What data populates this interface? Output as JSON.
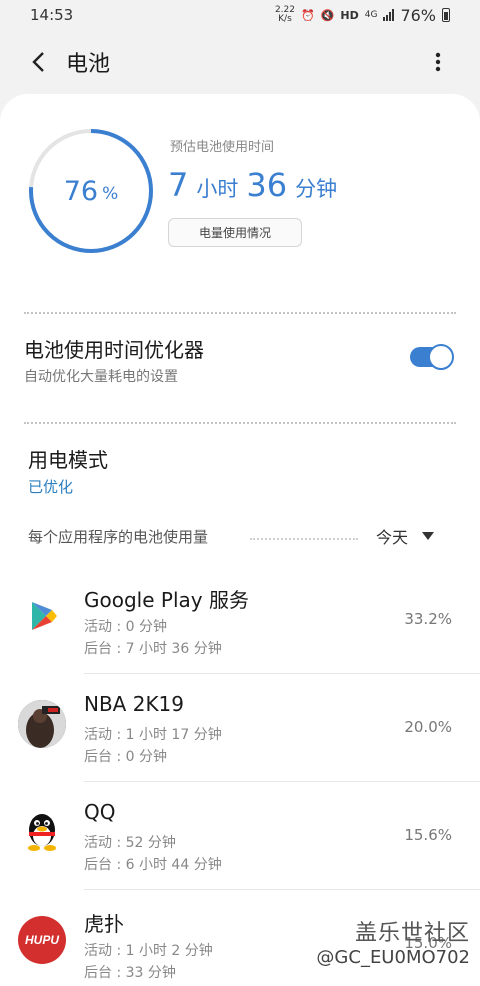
{
  "status_bar": {
    "time": "14:53",
    "net_speed_value": "2.22",
    "net_speed_unit": "K/s",
    "hd_label": "HD",
    "network": "4G",
    "battery_percent": "76%"
  },
  "header": {
    "title": "电池",
    "back_icon": "back-arrow-icon",
    "more_icon": "more-vert-icon"
  },
  "battery": {
    "level": 0.76,
    "percent_value": "76",
    "percent_sign": "%",
    "estimate_label": "预估电池使用时间",
    "hours": "7",
    "hours_unit": "小时",
    "minutes": "36",
    "minutes_unit": "分钟",
    "usage_button": "电量使用情况",
    "accent_color": "#3b7fd1"
  },
  "optimizer": {
    "title": "电池使用时间优化器",
    "subtitle": "自动优化大量耗电的设置",
    "enabled": true
  },
  "power_mode": {
    "title": "用电模式",
    "value": "已优化"
  },
  "app_usage": {
    "header": "每个应用程序的电池使用量",
    "period": "今天",
    "apps": [
      {
        "name": "Google Play 服务",
        "active": "活动 : 0 分钟",
        "background": "后台 : 7 小时 36 分钟",
        "percent": "33.2%",
        "icon": "google-play-services-icon"
      },
      {
        "name": "NBA 2K19",
        "active": "活动 : 1 小时 17 分钟",
        "background": "后台 : 0 分钟",
        "percent": "20.0%",
        "icon": "nba-2k19-icon"
      },
      {
        "name": "QQ",
        "active": "活动 : 52 分钟",
        "background": "后台 : 6 小时 44 分钟",
        "percent": "15.6%",
        "icon": "qq-penguin-icon"
      },
      {
        "name": "虎扑",
        "active": "活动 : 1 小时 2 分钟",
        "background": "后台 : 33 分钟",
        "percent": "15.0%",
        "icon": "hupu-icon",
        "icon_text": "HUPU"
      }
    ]
  },
  "watermark": {
    "line1": "盖乐世社区",
    "line2": "@GC_EU0MO702"
  }
}
